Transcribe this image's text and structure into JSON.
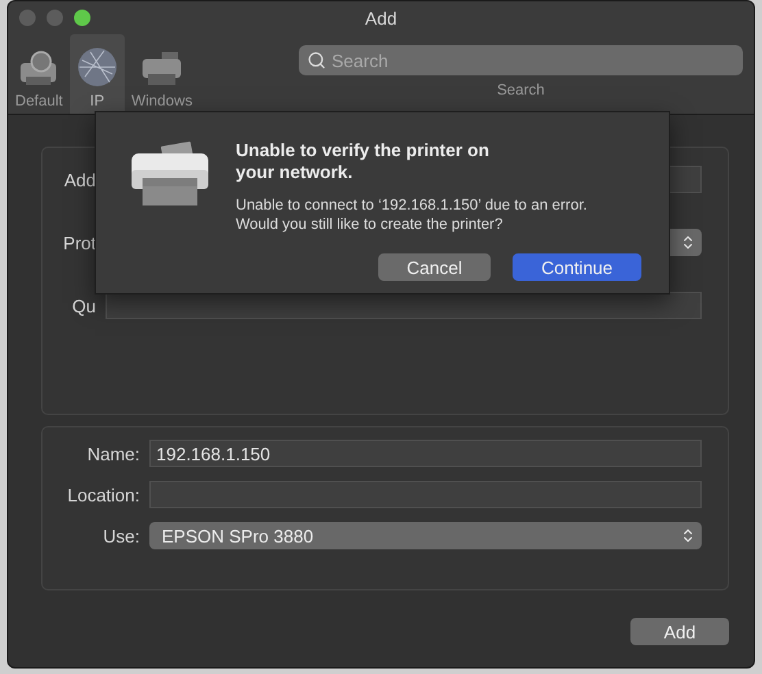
{
  "window": {
    "title": "Add"
  },
  "toolbar": {
    "tabs": [
      {
        "label": "Default",
        "kind": "default",
        "selected": false
      },
      {
        "label": "IP",
        "kind": "ip",
        "selected": true
      },
      {
        "label": "Windows",
        "kind": "windows",
        "selected": false
      }
    ],
    "search": {
      "placeholder": "Search",
      "caption": "Search"
    }
  },
  "top_panel": {
    "rows": [
      {
        "label": "Add",
        "kind": "field"
      },
      {
        "label": "Prot",
        "kind": "popup"
      },
      {
        "label": "Qu",
        "kind": "field"
      }
    ]
  },
  "bottom_panel": {
    "rows": [
      {
        "label": "Name:",
        "kind": "field",
        "value": "192.168.1.150"
      },
      {
        "label": "Location:",
        "kind": "field"
      },
      {
        "label": "Use:",
        "kind": "popup",
        "value": "EPSON SPro 3880"
      }
    ]
  },
  "sheet": {
    "title": "Unable to verify the printer on your network.",
    "message": "Unable to connect to ‘192.168.1.150’ due to an error. Would you still like to create the printer?",
    "buttons": [
      {
        "label": "Cancel",
        "default": false
      },
      {
        "label": "Continue",
        "default": true
      }
    ]
  },
  "buttons": [
    {
      "label": "Add"
    }
  ]
}
